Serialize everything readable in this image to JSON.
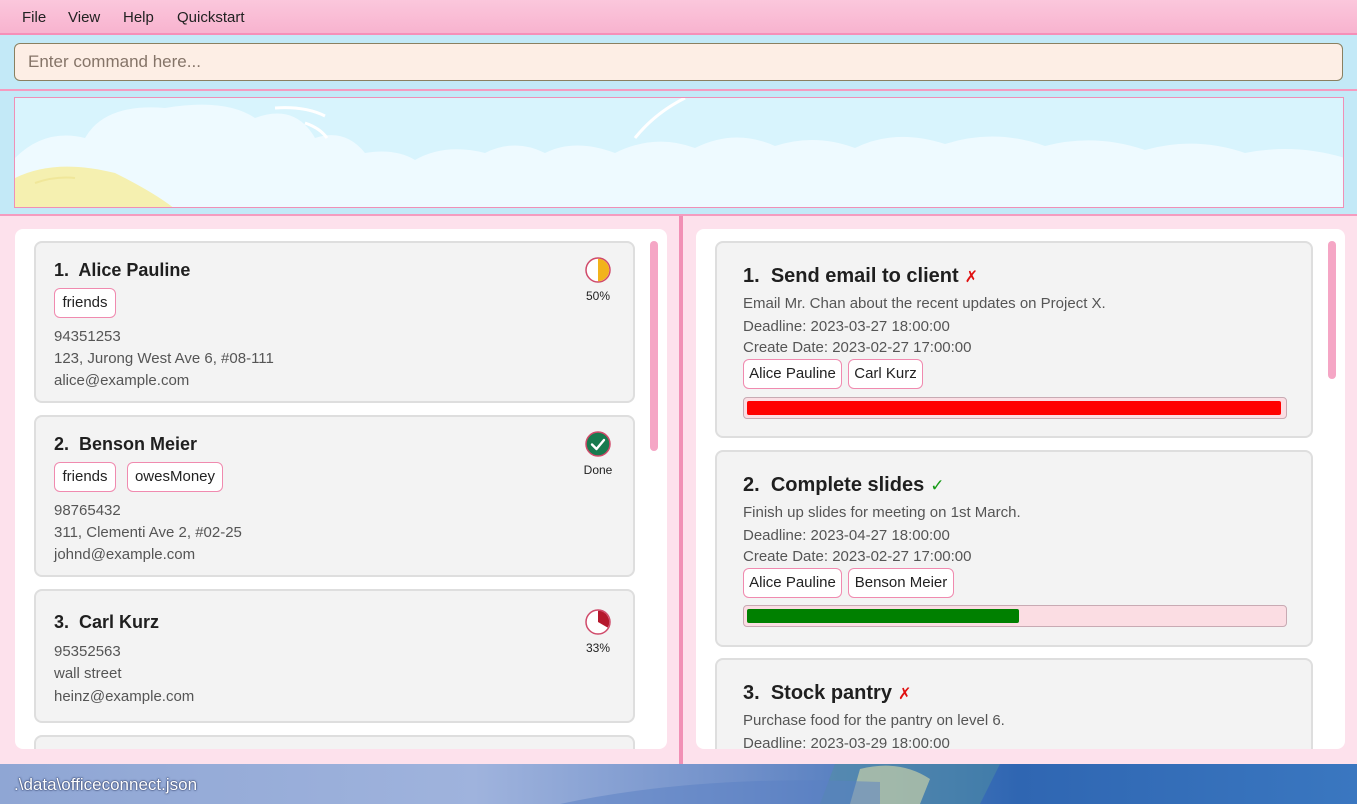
{
  "menu": {
    "file": "File",
    "view": "View",
    "help": "Help",
    "quickstart": "Quickstart"
  },
  "command": {
    "placeholder": "Enter command here..."
  },
  "persons": [
    {
      "index": "1.",
      "name": "Alice Pauline",
      "tags": [
        "friends"
      ],
      "phone": "94351253",
      "address": "123, Jurong West Ave 6, #08-111",
      "email": "alice@example.com",
      "status": "50%",
      "progress": 0.5,
      "status_icon": "half-pie-icon"
    },
    {
      "index": "2.",
      "name": "Benson Meier",
      "tags": [
        "friends",
        "owesMoney"
      ],
      "phone": "98765432",
      "address": "311, Clementi Ave 2, #02-25",
      "email": "johnd@example.com",
      "status": "Done",
      "progress": 1.0,
      "status_icon": "check-circle-icon"
    },
    {
      "index": "3.",
      "name": "Carl Kurz",
      "tags": [],
      "phone": "95352563",
      "address": "wall street",
      "email": "heinz@example.com",
      "status": "33%",
      "progress": 0.33,
      "status_icon": "third-pie-icon"
    }
  ],
  "tasks": [
    {
      "index": "1.",
      "title": "Send email to client",
      "mark": "✗",
      "description": "Email Mr. Chan about the recent updates on Project X.",
      "deadline": "Deadline: 2023-03-27 18:00:00",
      "created": "Create Date: 2023-02-27 17:00:00",
      "assignees": [
        "Alice Pauline",
        "Carl Kurz"
      ],
      "bar_fraction": 1.0,
      "bar_color": "#ff0000"
    },
    {
      "index": "2.",
      "title": "Complete slides",
      "mark": "✓",
      "description": "Finish up slides for meeting on 1st March.",
      "deadline": "Deadline: 2023-04-27 18:00:00",
      "created": "Create Date: 2023-02-27 17:00:00",
      "assignees": [
        "Alice Pauline",
        "Benson Meier"
      ],
      "bar_fraction": 0.51,
      "bar_color": "#008000"
    },
    {
      "index": "3.",
      "title": "Stock pantry",
      "mark": "✗",
      "description": "Purchase food for the pantry on level 6.",
      "deadline": "Deadline: 2023-03-29 18:00:00"
    }
  ],
  "status_bar": {
    "path": ".\\data\\officeconnect.json"
  },
  "colors": {
    "menu": "#f8b3cf",
    "accent_pink": "#f08aaf",
    "fail": "#ff0000",
    "success": "#008000"
  }
}
